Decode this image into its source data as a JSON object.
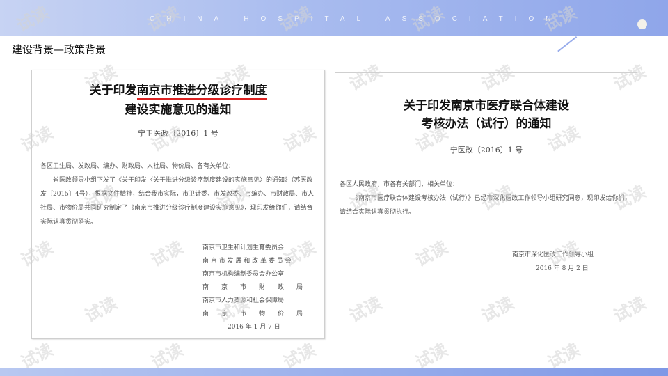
{
  "header": {
    "banner_text": "CHINA HOSPITAL ASSOCIATION",
    "slide_title": "建设背景—政策背景"
  },
  "doc1": {
    "title_pre": "关于印发",
    "title_highlight": "南京市推进分级诊疗制度",
    "title_line2": "建设实施意见的通知",
    "doc_number": "宁卫医政〔2016〕1 号",
    "addressee": "各区卫生局、发改局、编办、财政局、人社局、物价局、各有关单位：",
    "body": "省医改领导小组下发了《关于印发〈关于推进分级诊疗制度建设的实施意见〉的通知》（苏医改发〔2015〕4号），根据文件精神，结合我市实际，市卫计委、市发改委、市编办、市财政局、市人社局、市物价局共同研究制定了《南京市推进分级诊疗制度建设实施意见》，现印发给你们，请结合实际认真贯彻落实。",
    "signatures": [
      "南京市卫生和计划生育委员会",
      "南 京 市 发 展 和 改 革 委 员 会",
      "南京市机构编制委员会办公室",
      "南　　京　　市　　财　　政　　局",
      "南京市人力资源和社会保障局",
      "南　　京　　市　　物　　价　　局"
    ],
    "date": "2016 年 1 月 7 日"
  },
  "doc2": {
    "title_line1": "关于印发南京市医疗联合体建设",
    "title_line2": "考核办法（试行）的通知",
    "doc_number": "宁医改〔2016〕1 号",
    "addressee": "各区人民政府，市各有关部门，相关单位：",
    "body": "《南京市医疗联合体建设考核办法（试行）》已经市深化医改工作领导小组研究同意，现印发给你们，请结合实际认真贯彻执行。",
    "signature": "南京市深化医改工作领导小组",
    "date": "2016 年 8 月 2 日"
  },
  "watermark": "试读"
}
